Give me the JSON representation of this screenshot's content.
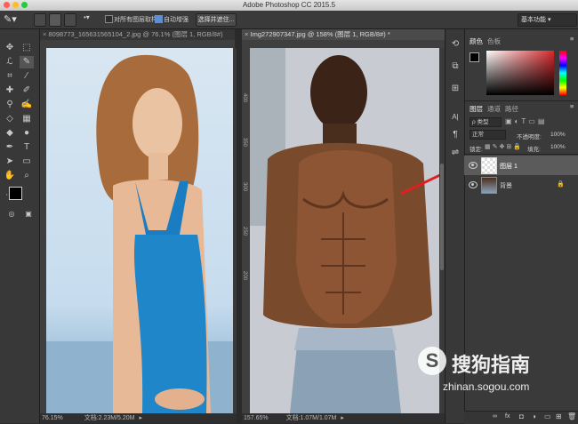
{
  "app": {
    "title": "Adobe Photoshop CC 2015.5"
  },
  "options_bar": {
    "sample_all_layers_label": "对所有图层取样",
    "auto_enhance_label": "自动增强",
    "select_and_mask_label": "选择并遮住...",
    "workspace": "基本功能"
  },
  "documents": {
    "left": {
      "tab": "8098773_165631565104_2.jpg @ 76.1% (图层 1, RGB/8#)",
      "zoom": "76.15%",
      "doc_info": "文档:2.23M/5.20M"
    },
    "right": {
      "tab": "Img272907347.jpg @ 158% (图层 1, RGB/8#) *",
      "zoom": "157.65%",
      "doc_info": "文档:1.07M/1.07M"
    }
  },
  "ruler_marks": [
    "400",
    "350",
    "300",
    "250",
    "200"
  ],
  "color_panel": {
    "tab_color": "颜色",
    "tab_swatches": "色板"
  },
  "layers_panel": {
    "tab_layers": "图层",
    "tab_channels": "通道",
    "tab_paths": "路径",
    "filter_kind": "ρ 类型",
    "blend_mode": "正常",
    "opacity_label": "不透明度:",
    "opacity_value": "100%",
    "lock_label": "锁定:",
    "fill_label": "填充:",
    "fill_value": "100%",
    "layers": [
      {
        "name": "图层 1"
      },
      {
        "name": "背景"
      }
    ],
    "footer_icons": "fx"
  },
  "watermark": {
    "brand": "搜狗指南",
    "url": "zhinan.sogou.com"
  },
  "colors": {
    "accent_selected": "#5b5b5b",
    "arrow": "#e02020",
    "highlight": "#5b8fd6"
  }
}
